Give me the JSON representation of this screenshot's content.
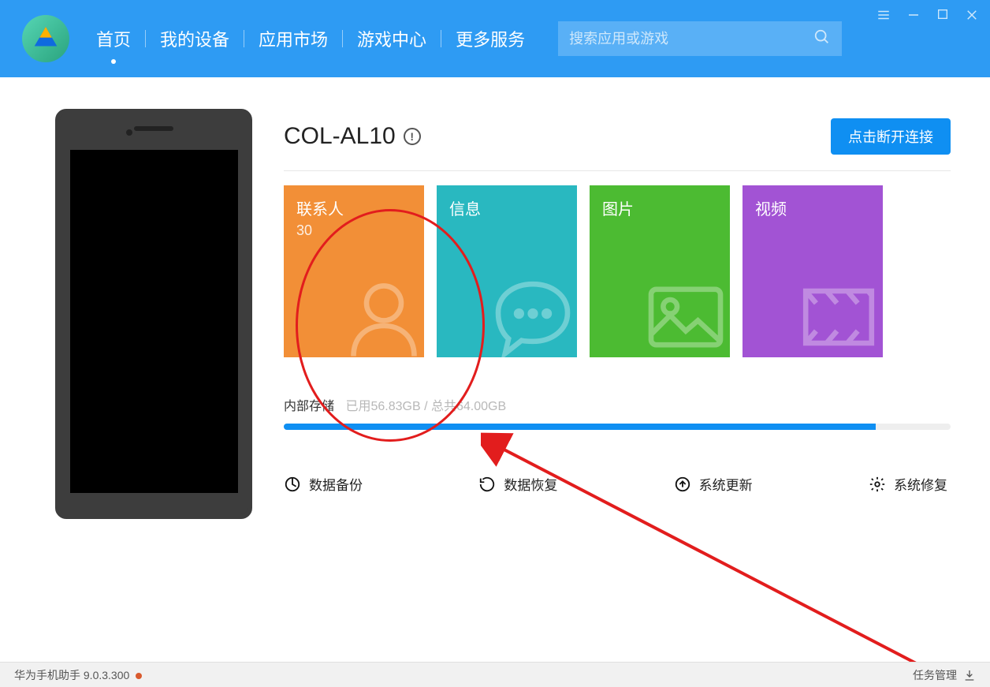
{
  "header": {
    "nav": [
      "首页",
      "我的设备",
      "应用市场",
      "游戏中心",
      "更多服务"
    ],
    "activeIndex": 0,
    "search": {
      "placeholder": "搜索应用或游戏"
    }
  },
  "device": {
    "name": "COL-AL10",
    "disconnect": "点击断开连接"
  },
  "tiles": {
    "contacts": {
      "title": "联系人",
      "count": "30"
    },
    "messages": {
      "title": "信息"
    },
    "pictures": {
      "title": "图片"
    },
    "videos": {
      "title": "视频"
    }
  },
  "storage": {
    "label": "内部存储",
    "usedText": "已用56.83GB / 总共64.00GB",
    "usedGB": 56.83,
    "totalGB": 64.0
  },
  "actions": {
    "backup": "数据备份",
    "restore": "数据恢复",
    "update": "系统更新",
    "repair": "系统修复"
  },
  "footer": {
    "appName": "华为手机助手",
    "version": "9.0.3.300",
    "taskManager": "任务管理"
  }
}
